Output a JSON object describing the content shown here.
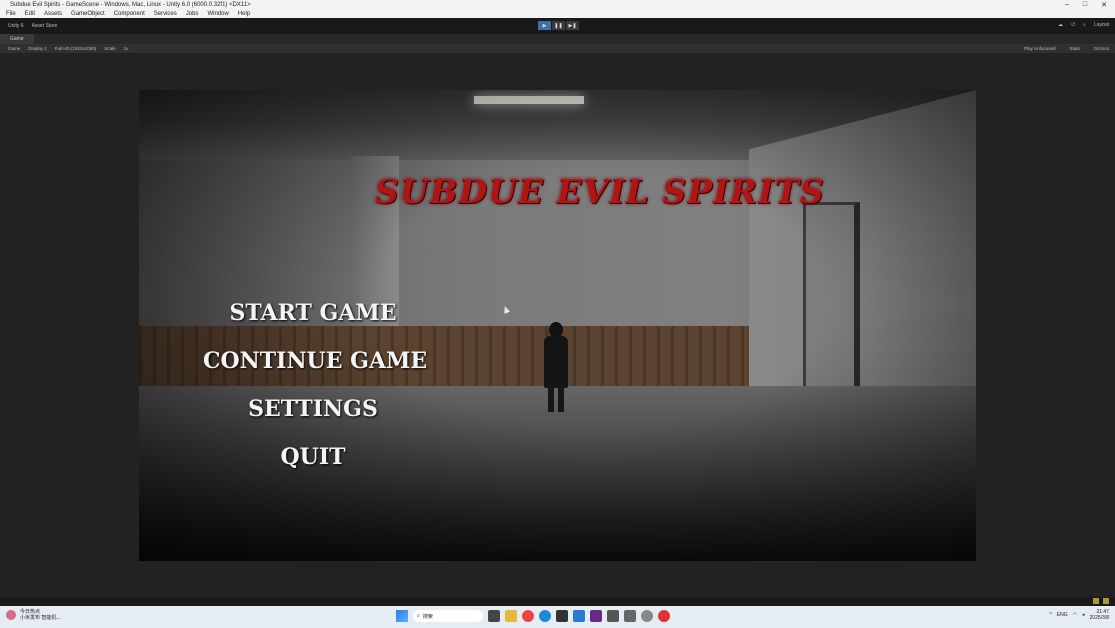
{
  "window": {
    "title": "Subdue Evil Spirits - GameScene - Windows, Mac, Linux - Unity 6.0 (6000.0.32f1) <DX11>",
    "controls": [
      "–",
      "□",
      "✕"
    ]
  },
  "menubar": {
    "items": [
      "File",
      "Edit",
      "Assets",
      "GameObject",
      "Component",
      "Services",
      "Jobs",
      "Window",
      "Help"
    ]
  },
  "toolbar": {
    "account": "Unity 6",
    "asset_store": "Asset Store",
    "layout": "Layout"
  },
  "game_tab": {
    "tab_label": "Game",
    "mode": "Game",
    "display": "Display 1",
    "resolution": "Full HD (1920x1080)",
    "scale_label": "Scale",
    "scale_value": "1x",
    "play_focused": "Play Unfocused",
    "stats": "Stats",
    "gizmos": "Gizmos"
  },
  "game": {
    "title": "SUBDUE EVIL SPIRITS",
    "menu": [
      "START GAME",
      "CONTINUE GAME",
      "SETTINGS",
      "QUIT"
    ]
  },
  "taskbar": {
    "weather_line1": "今日热点",
    "weather_line2": "小米发布 智能机...",
    "search_placeholder": "搜索",
    "language": "ENG",
    "time": "21:47",
    "date": "2025/3/8"
  },
  "colors": {
    "title_red": "#b01515",
    "menu_text": "#f4f4f4"
  }
}
